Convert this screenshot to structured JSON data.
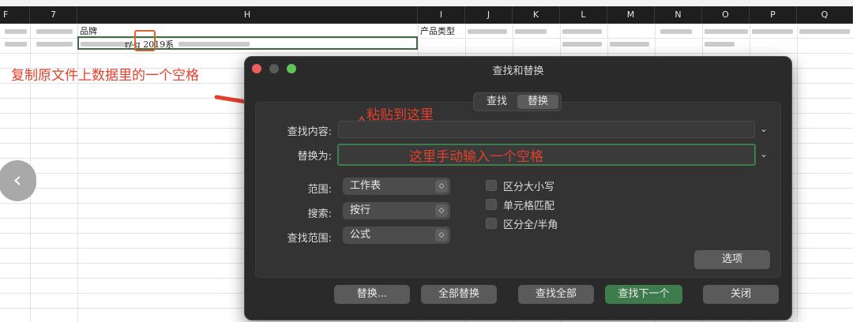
{
  "sheet": {
    "columns": [
      "F",
      "7",
      "H",
      "I",
      "J",
      "K",
      "L",
      "M",
      "N",
      "O",
      "P",
      "Q"
    ],
    "row1": {
      "h": "品牌",
      "i": "产品类型"
    },
    "row2": {
      "h_visible": "r/-g 2019系"
    }
  },
  "annotations": {
    "copy_note": "复制原文件上数据里的一个空格",
    "paste_note": "粘贴到这里",
    "type_note": "这里手动输入一个空格"
  },
  "nav": {
    "back_glyph": "‹"
  },
  "dialog": {
    "title": "查找和替换",
    "tabs": [
      "查找",
      "替换"
    ],
    "active_tab": "替换",
    "find_label": "查找内容:",
    "find_value": "",
    "replace_label": "替换为:",
    "replace_value": "",
    "scope_label": "范围:",
    "scope_value": "工作表",
    "search_label": "搜索:",
    "search_value": "按行",
    "look_in_label": "查找范围:",
    "look_in_value": "公式",
    "options": [
      {
        "label": "区分大小写",
        "checked": false
      },
      {
        "label": "单元格匹配",
        "checked": false
      },
      {
        "label": "区分全/半角",
        "checked": false
      }
    ],
    "options_button": "选项",
    "buttons": {
      "replace": "替换...",
      "replace_all": "全部替换",
      "find_all": "查找全部",
      "find_next": "查找下一个",
      "close": "关闭"
    },
    "colors": {
      "accent": "#3f7c4d",
      "annotation": "#e2402b",
      "traffic_red": "#ec5f59",
      "traffic_gray": "#5a5a5a",
      "traffic_green": "#5fc454"
    }
  }
}
